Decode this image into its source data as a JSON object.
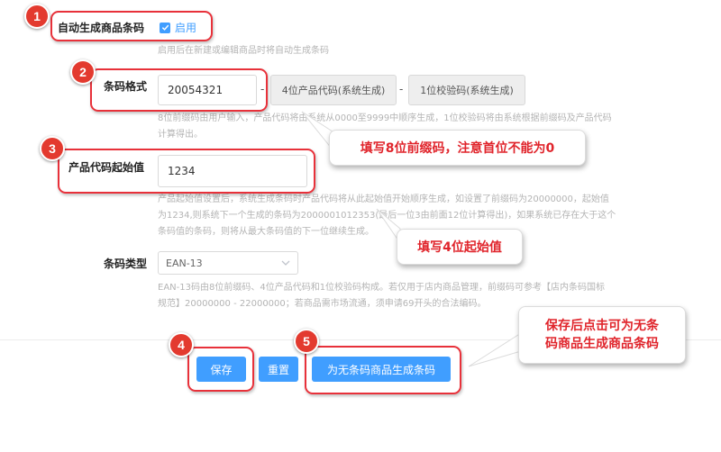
{
  "form": {
    "auto_barcode": {
      "label": "自动生成商品条码",
      "checkbox_label": "启用",
      "help": "启用后在新建或编辑商品时将自动生成条码"
    },
    "barcode_format": {
      "label": "条码格式",
      "prefix_value": "20054321",
      "separator": "-",
      "product_code_addon": "4位产品代码(系统生成)",
      "check_digit_addon": "1位校验码(系统生成)",
      "help_line1": "8位前缀码由用户输入，产品代码将由系统从0000至9999中顺序生成，1位校验码将由系统根据前缀码及产品代码",
      "help_line2": "计算得出。"
    },
    "product_code_start": {
      "label": "产品代码起始值",
      "value": "1234",
      "help_line1": "产品起始值设置后，系统生成条码时产品代码将从此起始值开始顺序生成，如设置了前缀码为20000000，起始值",
      "help_line2": "为1234,则系统下一个生成的条码为2000001012353(最后一位3由前面12位计算得出)，如果系统已存在大于这个",
      "help_line3": "条码值的条码，则将从最大条码值的下一位继续生成。"
    },
    "barcode_type": {
      "label": "条码类型",
      "selected": "EAN-13",
      "help_line1": "EAN-13码由8位前缀码、4位产品代码和1位校验码构成。若仅用于店内商品管理，前缀码可参考【店内条码国标",
      "help_line2": "规范】20000000 - 22000000；若商品需市场流通，须申请69开头的合法编码。"
    }
  },
  "buttons": {
    "save": "保存",
    "reset": "重置",
    "generate": "为无条码商品生成条码"
  },
  "annotations": {
    "badges": [
      "1",
      "2",
      "3",
      "4",
      "5"
    ],
    "callout_prefix": "填写8位前缀码，注意首位不能为0",
    "callout_start": "填写4位起始值",
    "callout_generate_line1": "保存后点击可为无条",
    "callout_generate_line2": "码商品生成商品条码"
  },
  "colors": {
    "primary": "#409eff",
    "annotation_red": "#e8313a",
    "addon_bg": "#eeeeee",
    "help_text": "#b4b4b4"
  }
}
